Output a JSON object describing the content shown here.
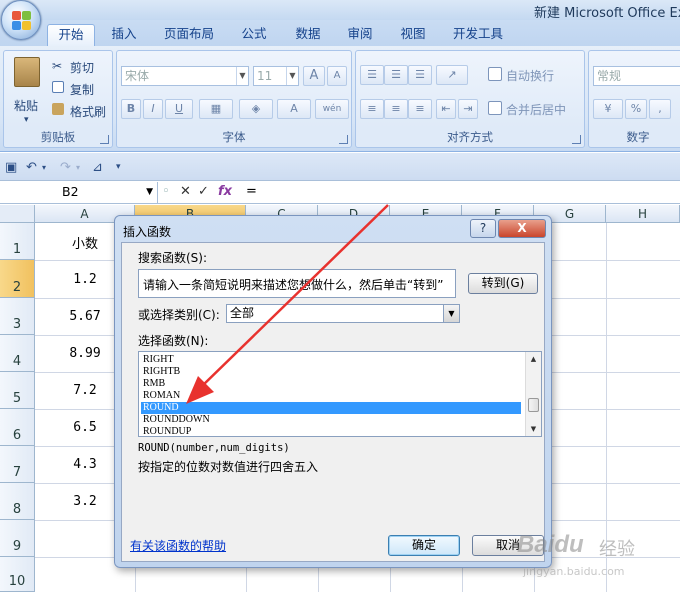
{
  "window": {
    "title": "新建 Microsoft Office Exc"
  },
  "tabs": [
    "开始",
    "插入",
    "页面布局",
    "公式",
    "数据",
    "审阅",
    "视图",
    "开发工具"
  ],
  "active_tab": "开始",
  "ribbon": {
    "clipboard": {
      "paste": "粘贴",
      "cut": "剪切",
      "copy": "复制",
      "format_painter": "格式刷",
      "label": "剪贴板"
    },
    "font": {
      "name": "宋体",
      "size": "11",
      "bold": "B",
      "italic": "I",
      "underline": "U",
      "grow": "A",
      "shrink": "A",
      "wen": "wén",
      "label": "字体"
    },
    "alignment": {
      "wrap": "自动换行",
      "merge": "合并后居中",
      "label": "对齐方式"
    },
    "number": {
      "format": "常规",
      "percent": "%",
      "comma": ",",
      "label": "数字"
    }
  },
  "formula_bar": {
    "cell_ref": "B2",
    "fx": "fx",
    "formula": "="
  },
  "grid": {
    "columns": [
      "A",
      "B",
      "C",
      "D",
      "E",
      "F",
      "G",
      "H"
    ],
    "rows": [
      "1",
      "2",
      "3",
      "4",
      "5",
      "6",
      "7",
      "8",
      "9",
      "10"
    ],
    "col_a_values": [
      "小数",
      "1.2",
      "5.67",
      "8.99",
      "7.2",
      "6.5",
      "4.3",
      "3.2",
      "",
      ""
    ]
  },
  "dialog": {
    "title": "插入函数",
    "help_btn": "?",
    "close_btn": "X",
    "search_label": "搜索函数(S):",
    "search_value": "请输入一条简短说明来描述您想做什么，然后单击“转到”",
    "goto_btn": "转到(G)",
    "category_label": "或选择类别(C):",
    "category_value": "全部",
    "list_label": "选择函数(N):",
    "functions": [
      "RIGHT",
      "RIGHTB",
      "RMB",
      "ROMAN",
      "ROUND",
      "ROUNDDOWN",
      "ROUNDUP"
    ],
    "selected_function": "ROUND",
    "syntax": "ROUND(number,num_digits)",
    "description": "按指定的位数对数值进行四舍五入",
    "help_link": "有关该函数的帮助",
    "ok_btn": "确定",
    "cancel_btn": "取消"
  },
  "watermark": {
    "bai": "Baidu",
    "jingyan": "经验",
    "url": "jingyan.baidu.com"
  },
  "colors": {
    "selection": "#3399ff",
    "arrow": "#e8322e",
    "header_selected": "#f1c15f"
  }
}
